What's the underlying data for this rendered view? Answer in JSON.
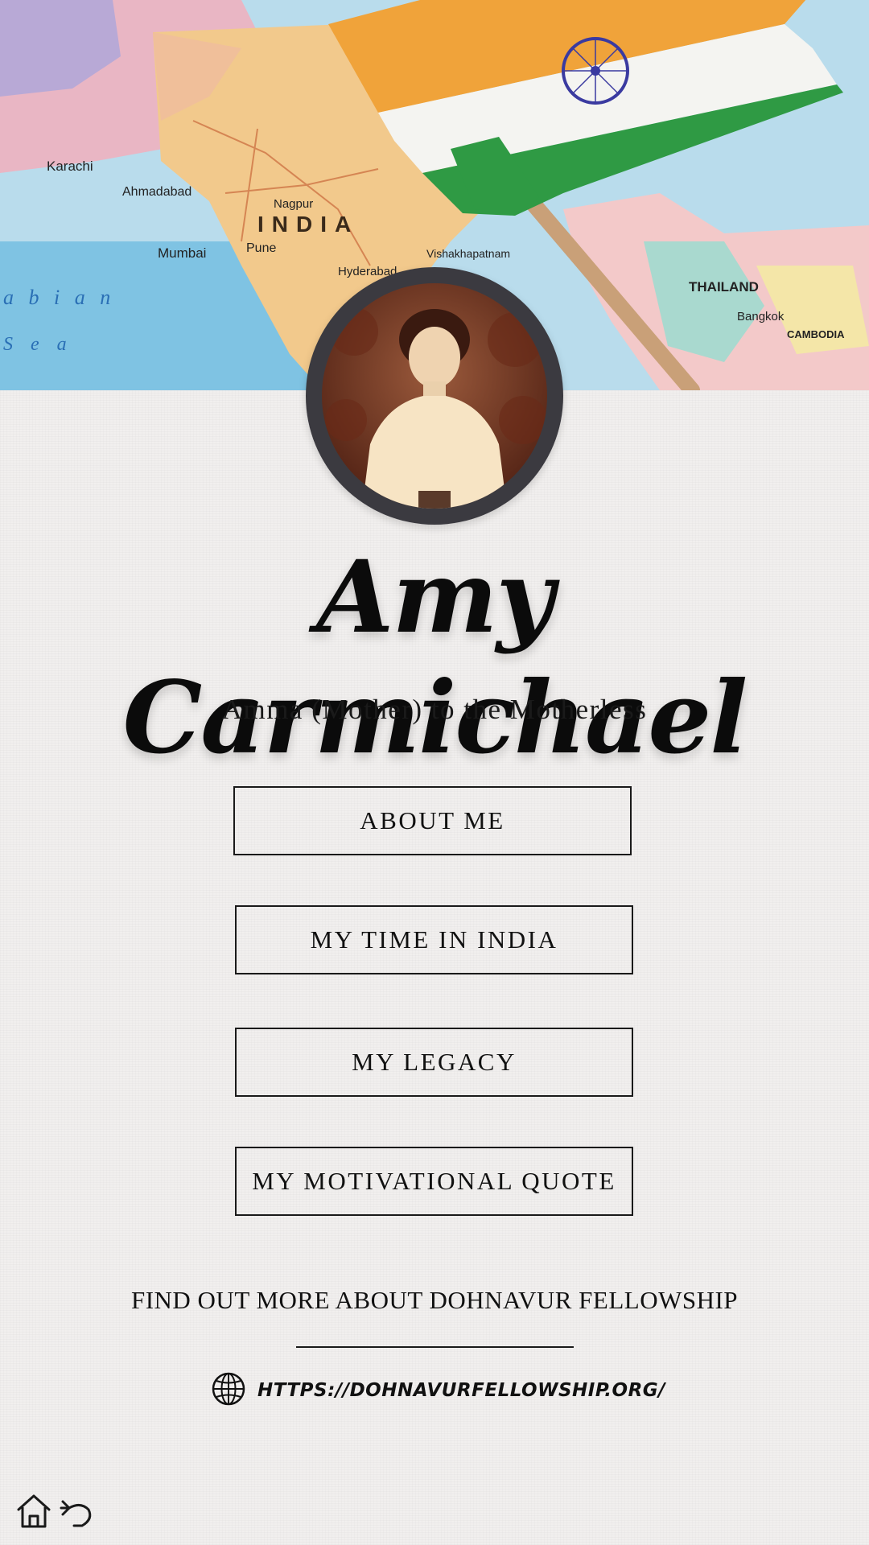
{
  "hero": {
    "map_labels": {
      "karachi": "Karachi",
      "ahmadabad": "Ahmadabad",
      "india": "INDIA",
      "mumbai": "Mumbai",
      "pune": "Pune",
      "nagpur": "Nagpur",
      "hyderabad": "Hyderabad",
      "visakhapatnam": "Vishakhapatnam",
      "thailand": "THAILAND",
      "bangkok": "Bangkok",
      "cambodia": "CAMBODIA",
      "arabian": "a b i a n",
      "sea": "S e a"
    },
    "colors": {
      "saffron": "#f0a33a",
      "white": "#f4f4f1",
      "green": "#2f9a44",
      "chakra": "#3a3aa0",
      "ring": "#3b3a40"
    }
  },
  "profile": {
    "name": "Amy Carmichael",
    "tagline": "Amma (Mother) to the Motherless"
  },
  "nav": {
    "about": "ABOUT ME",
    "india": "MY TIME IN INDIA",
    "legacy": "MY LEGACY",
    "quote": "MY MOTIVATIONAL QUOTE"
  },
  "footer": {
    "more_label": "FIND OUT MORE ABOUT DOHNAVUR FELLOWSHIP",
    "link": "HTTPS://DOHNAVURFELLOWSHIP.ORG/"
  },
  "icons": {
    "home": "home-icon",
    "back": "back-arrow-icon",
    "globe": "globe-icon"
  }
}
